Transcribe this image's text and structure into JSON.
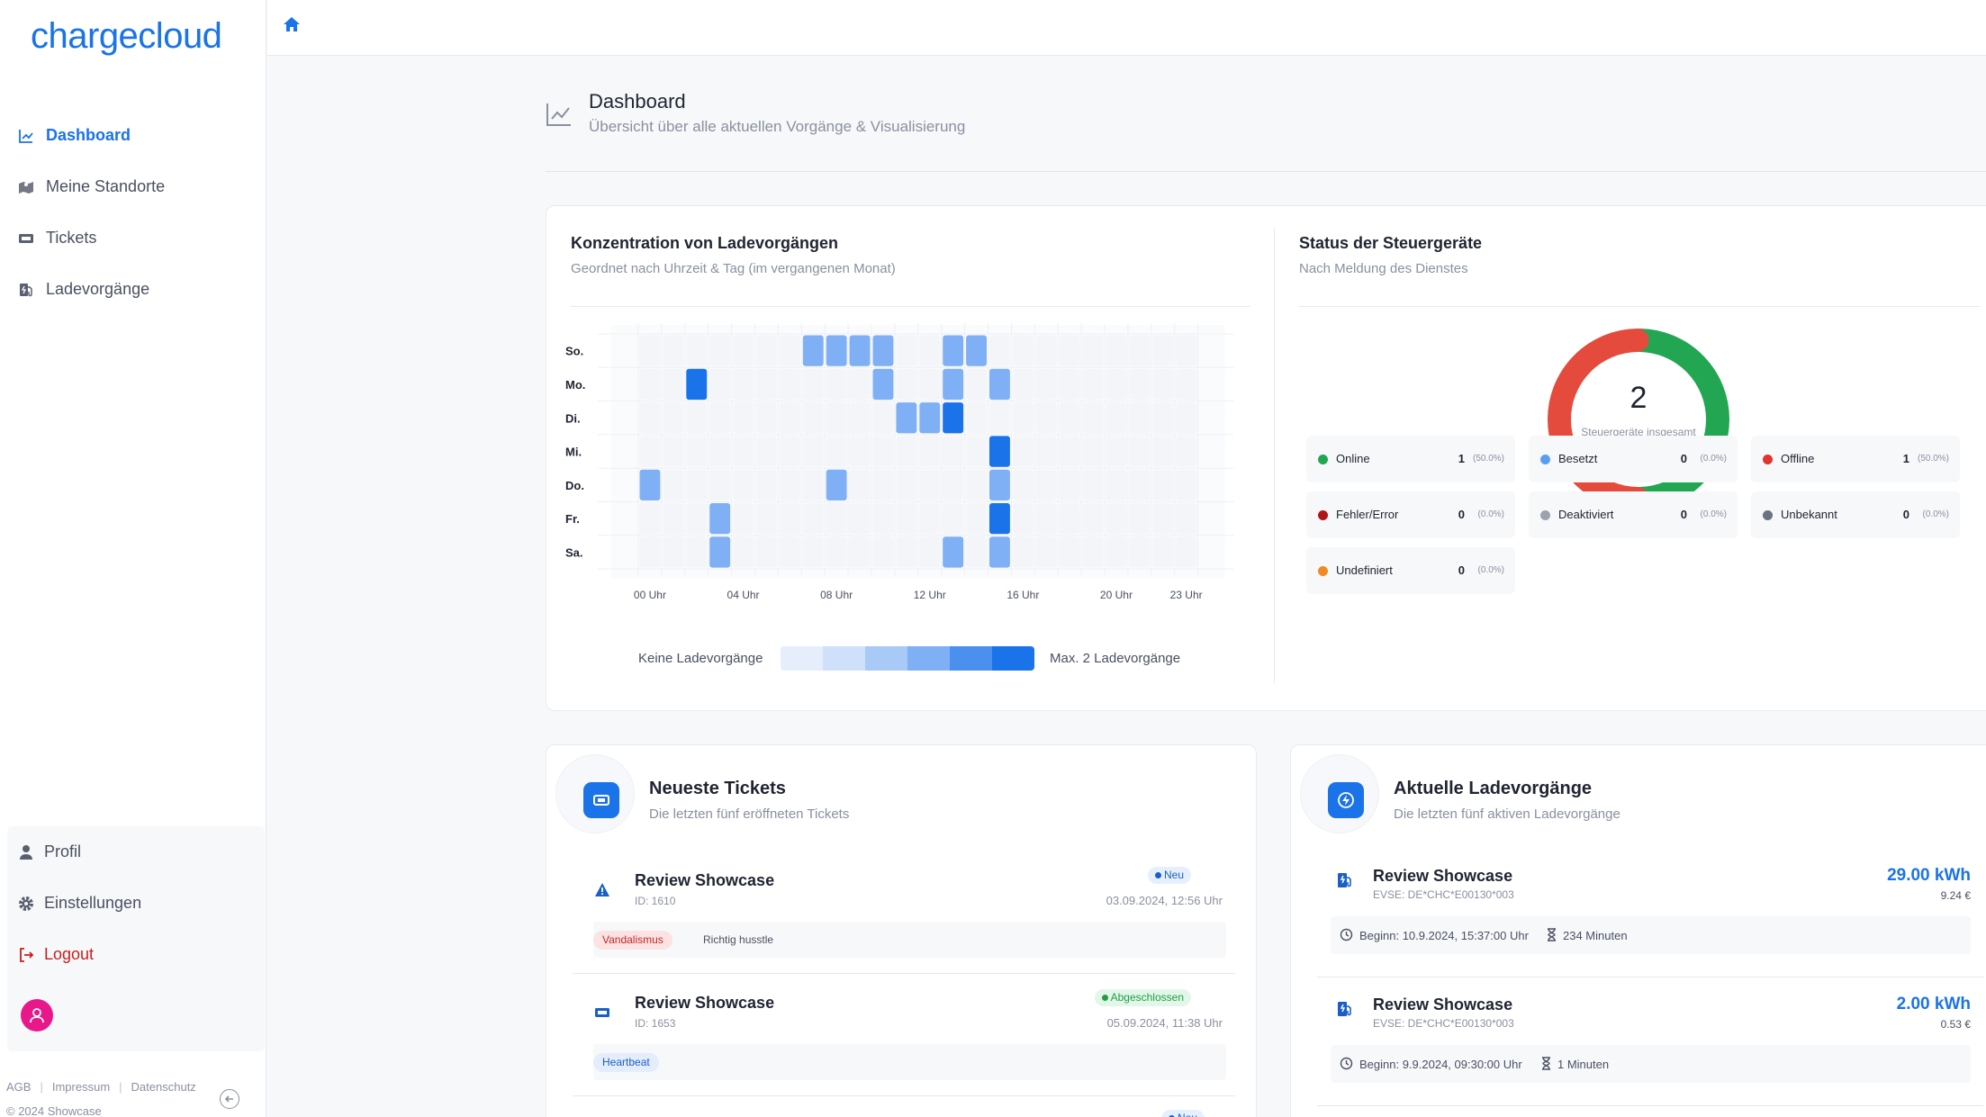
{
  "brand": {
    "logo_text": "chargecloud",
    "accent": "#1a73e8"
  },
  "sidebar": {
    "items": [
      {
        "label": "Dashboard",
        "icon": "chart-line-icon",
        "active": true
      },
      {
        "label": "Meine Standorte",
        "icon": "map-icon",
        "active": false
      },
      {
        "label": "Tickets",
        "icon": "ticket-icon",
        "active": false
      },
      {
        "label": "Ladevorgänge",
        "icon": "charging-station-icon",
        "active": false
      }
    ],
    "bottom": {
      "profile": "Profil",
      "settings": "Einstellungen",
      "logout": "Logout"
    },
    "footer": {
      "agb": "AGB",
      "impressum": "Impressum",
      "datenschutz": "Datenschutz",
      "copyright": "© 2024 Showcase"
    }
  },
  "page": {
    "title": "Dashboard",
    "subtitle": "Übersicht über alle aktuellen Vorgänge & Visualisierung"
  },
  "heatmap": {
    "title": "Konzentration von Ladevorgängen",
    "subtitle": "Geordnet nach Uhrzeit & Tag (im vergangenen Monat)",
    "legend_min": "Keine Ladevorgänge",
    "legend_max": "Max. 2 Ladevorgänge"
  },
  "chart_data": {
    "type": "heatmap",
    "title": "Konzentration von Ladevorgängen",
    "rows": [
      "So.",
      "Mo.",
      "Di.",
      "Mi.",
      "Do.",
      "Fr.",
      "Sa."
    ],
    "columns": [
      "00",
      "01",
      "02",
      "03",
      "04",
      "05",
      "06",
      "07",
      "08",
      "09",
      "10",
      "11",
      "12",
      "13",
      "14",
      "15",
      "16",
      "17",
      "18",
      "19",
      "20",
      "21",
      "22",
      "23"
    ],
    "x_tick_labels": [
      "00 Uhr",
      "04 Uhr",
      "08 Uhr",
      "12 Uhr",
      "16 Uhr",
      "20 Uhr",
      "23 Uhr"
    ],
    "x_tick_hours": [
      0,
      4,
      8,
      12,
      16,
      20,
      23
    ],
    "max": 2,
    "cells": [
      {
        "day": "So.",
        "hour": 7,
        "value": 1
      },
      {
        "day": "So.",
        "hour": 8,
        "value": 1
      },
      {
        "day": "So.",
        "hour": 9,
        "value": 1
      },
      {
        "day": "So.",
        "hour": 10,
        "value": 1
      },
      {
        "day": "So.",
        "hour": 13,
        "value": 1
      },
      {
        "day": "So.",
        "hour": 14,
        "value": 1
      },
      {
        "day": "Mo.",
        "hour": 2,
        "value": 2
      },
      {
        "day": "Mo.",
        "hour": 10,
        "value": 1
      },
      {
        "day": "Mo.",
        "hour": 13,
        "value": 1
      },
      {
        "day": "Mo.",
        "hour": 15,
        "value": 1
      },
      {
        "day": "Di.",
        "hour": 11,
        "value": 1
      },
      {
        "day": "Di.",
        "hour": 12,
        "value": 1
      },
      {
        "day": "Di.",
        "hour": 13,
        "value": 2
      },
      {
        "day": "Mi.",
        "hour": 15,
        "value": 2
      },
      {
        "day": "Do.",
        "hour": 0,
        "value": 1
      },
      {
        "day": "Do.",
        "hour": 8,
        "value": 1
      },
      {
        "day": "Do.",
        "hour": 15,
        "value": 1
      },
      {
        "day": "Fr.",
        "hour": 3,
        "value": 1
      },
      {
        "day": "Fr.",
        "hour": 15,
        "value": 2
      },
      {
        "day": "Sa.",
        "hour": 3,
        "value": 1
      },
      {
        "day": "Sa.",
        "hour": 13,
        "value": 1
      },
      {
        "day": "Sa.",
        "hour": 15,
        "value": 1
      }
    ],
    "colors": {
      "empty": "#f3f5f9",
      "mid": "#7fb0f5",
      "max": "#1a73e8"
    },
    "legend_scale": [
      "#e6eefb",
      "#cfe0fa",
      "#a9c9f7",
      "#7fb0f5",
      "#4b90ef",
      "#1a73e8"
    ]
  },
  "status": {
    "title": "Status der Steuergeräte",
    "subtitle": "Nach Meldung des Dienstes",
    "total": "2",
    "total_label": "Steuergeräte insgesamt",
    "items": [
      {
        "name": "Online",
        "value": "1",
        "pct": "(50.0%)",
        "color": "#22a652"
      },
      {
        "name": "Besetzt",
        "value": "0",
        "pct": "(0.0%)",
        "color": "#5b9ef0"
      },
      {
        "name": "Offline",
        "value": "1",
        "pct": "(50.0%)",
        "color": "#e0352f"
      },
      {
        "name": "Fehler/Error",
        "value": "0",
        "pct": "(0.0%)",
        "color": "#b0151a"
      },
      {
        "name": "Deaktiviert",
        "value": "0",
        "pct": "(0.0%)",
        "color": "#9ca3af"
      },
      {
        "name": "Unbekannt",
        "value": "0",
        "pct": "(0.0%)",
        "color": "#6b7280"
      },
      {
        "name": "Undefiniert",
        "value": "0",
        "pct": "(0.0%)",
        "color": "#f08a24"
      }
    ],
    "donut": [
      {
        "name": "Online",
        "value": 1,
        "color": "#22a652"
      },
      {
        "name": "Offline",
        "value": 1,
        "color": "#e54b3c"
      }
    ]
  },
  "tickets": {
    "title": "Neueste Tickets",
    "subtitle": "Die letzten fünf eröffneten Tickets",
    "items": [
      {
        "title": "Review Showcase",
        "id": "ID: 1610",
        "status": "Neu",
        "date": "03.09.2024, 12:56 Uhr",
        "tag": "Vandalismus",
        "note": "Richtig husstle",
        "icon": "warning-icon"
      },
      {
        "title": "Review Showcase",
        "id": "ID: 1653",
        "status": "Abgeschlossen",
        "date": "05.09.2024, 11:38 Uhr",
        "tag": "Heartbeat",
        "note": "",
        "icon": "ticket-icon"
      }
    ],
    "third_status": "Neu"
  },
  "charges": {
    "title": "Aktuelle Ladevorgänge",
    "subtitle": "Die letzten fünf aktiven Ladevorgänge",
    "items": [
      {
        "title": "Review Showcase",
        "evse": "EVSE: DE*CHC*E00130*003",
        "kwh": "29.00 kWh",
        "eur": "9.24 €",
        "start": "Beginn: 10.9.2024, 15:37:00 Uhr",
        "duration": "234 Minuten"
      },
      {
        "title": "Review Showcase",
        "evse": "EVSE: DE*CHC*E00130*003",
        "kwh": "2.00 kWh",
        "eur": "0.53 €",
        "start": "Beginn: 9.9.2024, 09:30:00 Uhr",
        "duration": "1 Minuten"
      }
    ]
  }
}
